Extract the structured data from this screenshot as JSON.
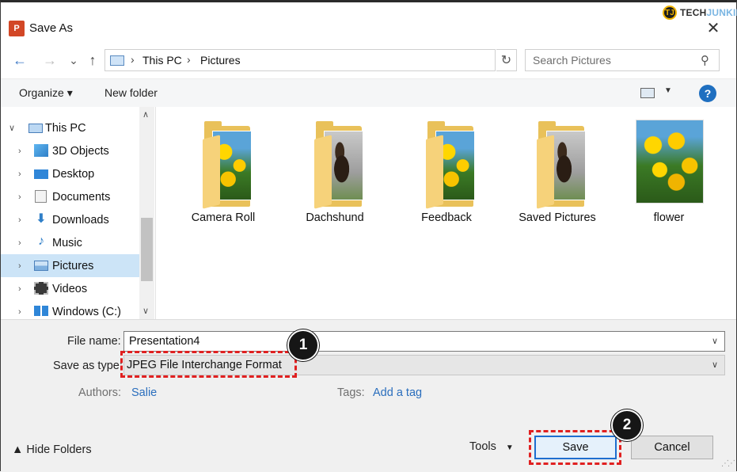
{
  "watermark": {
    "logo": "TJ",
    "text_prefix": "TECH",
    "text_suffix": "JUNKIE"
  },
  "window": {
    "title": "Save As",
    "app_icon": "powerpoint-icon",
    "close_glyph": "✕"
  },
  "nav": {
    "back_glyph": "←",
    "forward_glyph": "→",
    "recent_glyph": "⌄",
    "up_glyph": "↑",
    "breadcrumb": [
      "This PC",
      "Pictures"
    ],
    "refresh_glyph": "↻",
    "search_placeholder": "Search Pictures",
    "search_glyph": "⚲"
  },
  "toolbar": {
    "organize_label": "Organize ▾",
    "new_folder_label": "New folder",
    "help_glyph": "?"
  },
  "tree": {
    "items": [
      {
        "label": "This PC",
        "icon": "computer-icon"
      },
      {
        "label": "3D Objects",
        "icon": "cube-icon"
      },
      {
        "label": "Desktop",
        "icon": "desktop-icon"
      },
      {
        "label": "Documents",
        "icon": "documents-icon"
      },
      {
        "label": "Downloads",
        "icon": "download-icon"
      },
      {
        "label": "Music",
        "icon": "music-icon"
      },
      {
        "label": "Pictures",
        "icon": "pictures-icon",
        "selected": true
      },
      {
        "label": "Videos",
        "icon": "video-icon"
      },
      {
        "label": "Windows (C:)",
        "icon": "drive-icon"
      }
    ]
  },
  "files": [
    {
      "label": "Camera Roll",
      "kind": "folder",
      "thumb": "flowers"
    },
    {
      "label": "Dachshund",
      "kind": "folder",
      "thumb": "dog"
    },
    {
      "label": "Feedback",
      "kind": "folder",
      "thumb": "flowers"
    },
    {
      "label": "Saved Pictures",
      "kind": "folder",
      "thumb": "dog"
    },
    {
      "label": "flower",
      "kind": "image",
      "thumb": "flowers"
    }
  ],
  "form": {
    "file_name_label": "File name:",
    "file_name_value": "Presentation4",
    "save_type_label": "Save as type:",
    "save_type_value": "JPEG File Interchange Format",
    "authors_label": "Authors:",
    "authors_value": "Salie",
    "tags_label": "Tags:",
    "tags_value": "Add a tag"
  },
  "footer": {
    "hide_folders_label": "▲  Hide Folders",
    "tools_label": "Tools",
    "tools_glyph": "▼",
    "save_label": "Save",
    "cancel_label": "Cancel"
  },
  "annotations": {
    "badge1": "1",
    "badge2": "2",
    "color": "#e02020"
  }
}
